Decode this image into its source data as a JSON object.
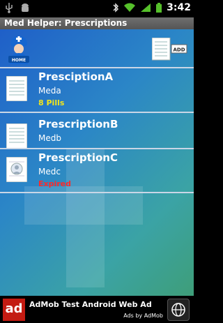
{
  "status_bar": {
    "time": "3:42"
  },
  "app_title": "Med Helper: Prescriptions",
  "toolbar": {
    "home_label": "HOME",
    "add_label": "ADD"
  },
  "prescriptions": [
    {
      "name": "PresciptionA",
      "medication": "Meda",
      "status": "8 Pills",
      "status_color": "#f3e61b"
    },
    {
      "name": "PrescriptionB",
      "medication": "Medb",
      "status": "",
      "status_color": ""
    },
    {
      "name": "PrescriptionC",
      "medication": "Medc",
      "status": "Expired",
      "status_color": "#ff2a2a"
    }
  ],
  "ad": {
    "logo": "ad",
    "text": "AdMob Test Android Web Ad",
    "byline": "Ads by AdMob"
  }
}
